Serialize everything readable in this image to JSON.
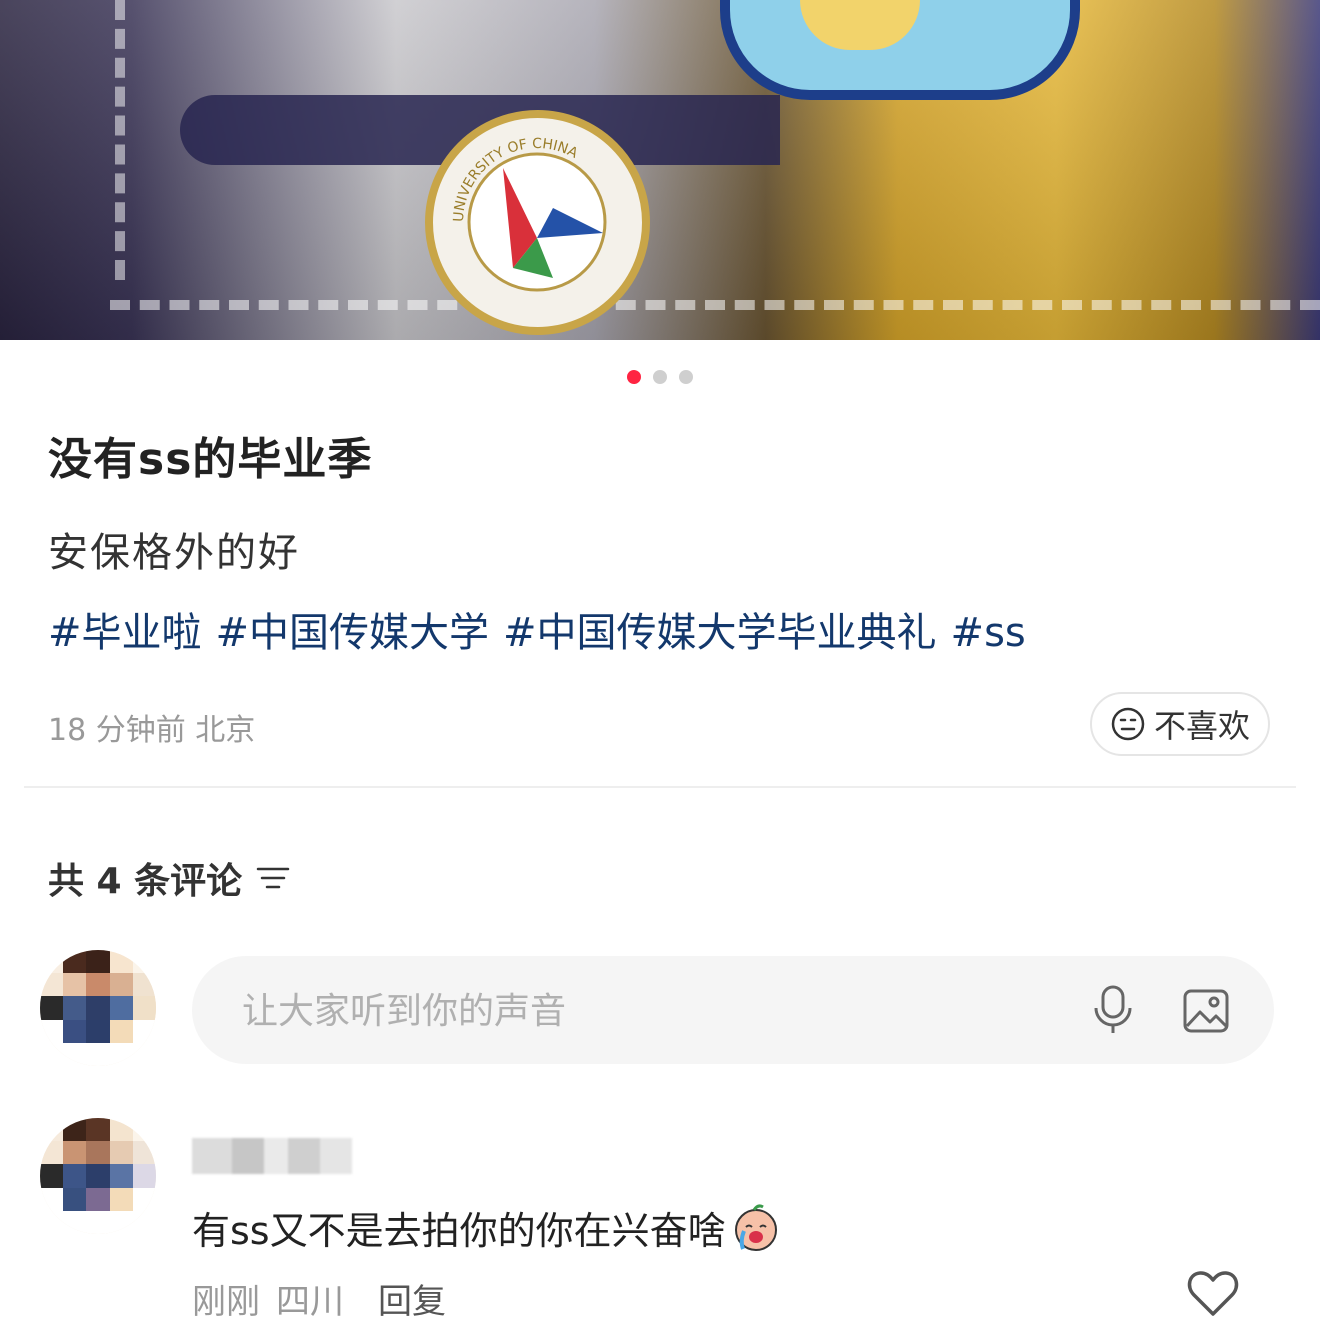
{
  "post": {
    "title": "没有ss的毕业季",
    "body": "安保格外的好",
    "tags": [
      "#毕业啦",
      "#中国传媒大学",
      "#中国传媒大学毕业典礼",
      "#ss"
    ],
    "time": "18 分钟前",
    "location": "北京",
    "dislike_label": "不喜欢",
    "photo_badge_text": "UNIVERSITY OF CHINA"
  },
  "carousel": {
    "count": 3,
    "active_index": 0,
    "active_color": "#ff2442"
  },
  "comments": {
    "count_label": "共 4  条评论",
    "input_placeholder": "让大家听到你的声音",
    "items": [
      {
        "text": "有ss又不是去拍你的你在兴奋啥",
        "time": "刚刚",
        "location": "四川",
        "reply_label": "回复"
      }
    ]
  },
  "icons": [
    "dislike-face-icon",
    "sort-icon",
    "microphone-icon",
    "image-icon",
    "crying-emoji-icon",
    "heart-icon"
  ],
  "colors": {
    "tag": "#13386c",
    "accent": "#ff2442",
    "meta": "#999999"
  }
}
